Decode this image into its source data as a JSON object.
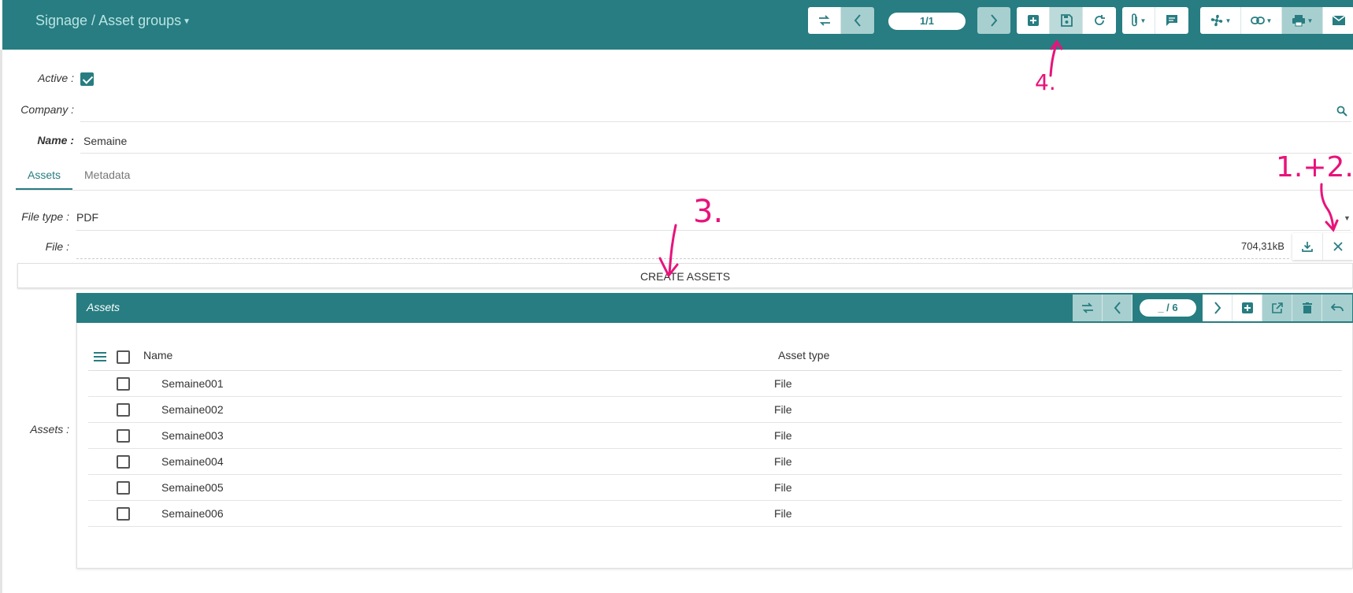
{
  "header": {
    "breadcrumb": "Signage / Asset groups",
    "pager": "1/1"
  },
  "form": {
    "active_label": "Active :",
    "active_checked": true,
    "company_label": "Company :",
    "company_value": "",
    "name_label": "Name :",
    "name_value": "Semaine"
  },
  "tabs": [
    {
      "label": "Assets",
      "active": true
    },
    {
      "label": "Metadata",
      "active": false
    }
  ],
  "file": {
    "type_label": "File type :",
    "type_value": "PDF",
    "file_label": "File :",
    "size": "704,31kB"
  },
  "create_button": "CREATE ASSETS",
  "assets_label": "Assets :",
  "assets_panel": {
    "title": "Assets",
    "pager": "_ / 6",
    "columns": [
      "Name",
      "Asset type"
    ],
    "rows": [
      {
        "name": "Semaine001",
        "type": "File"
      },
      {
        "name": "Semaine002",
        "type": "File"
      },
      {
        "name": "Semaine003",
        "type": "File"
      },
      {
        "name": "Semaine004",
        "type": "File"
      },
      {
        "name": "Semaine005",
        "type": "File"
      },
      {
        "name": "Semaine006",
        "type": "File"
      }
    ]
  },
  "annotations": {
    "step4": "4.",
    "step12": "1.+2.",
    "step3": "3."
  },
  "colors": {
    "primary": "#277d81",
    "annotation": "#e8137a"
  }
}
